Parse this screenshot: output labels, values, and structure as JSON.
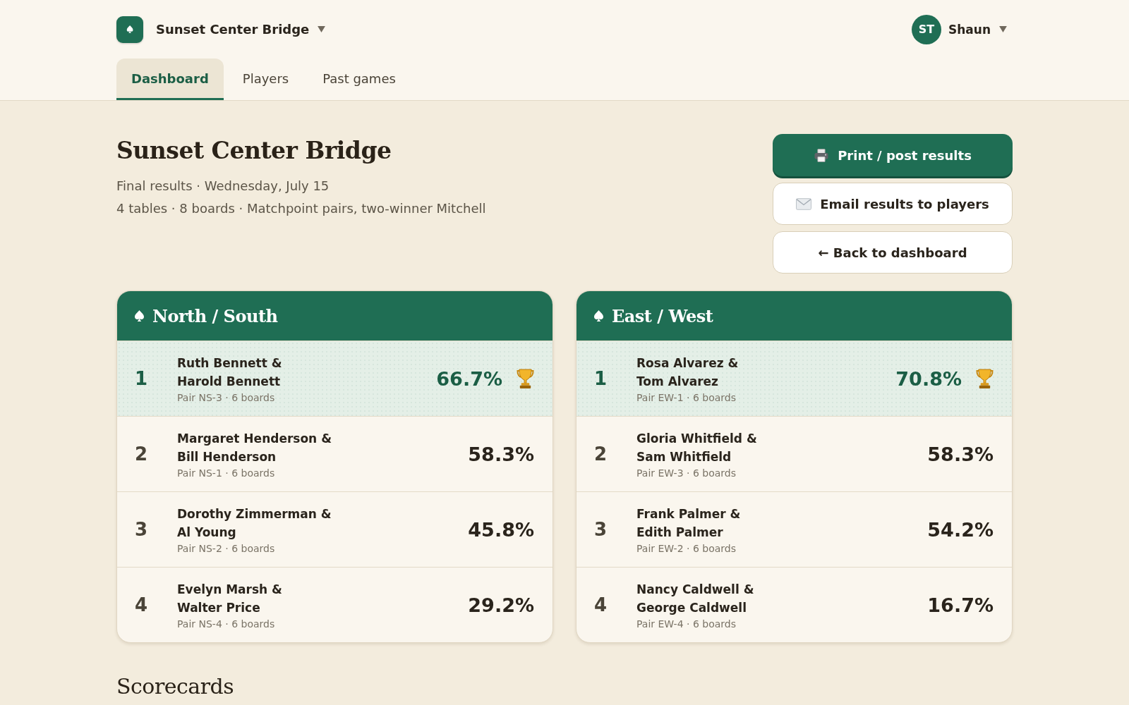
{
  "header": {
    "club": "Sunset Center Bridge",
    "user": {
      "initials": "ST",
      "name": "Shaun"
    }
  },
  "tabs": [
    {
      "label": "Dashboard",
      "selected": true
    },
    {
      "label": "Players",
      "selected": false
    },
    {
      "label": "Past games",
      "selected": false
    }
  ],
  "page": {
    "title": "Sunset Center Bridge",
    "subtitle_lines": [
      "Final results · Wednesday, July 15",
      "4 tables · 8 boards · Matchpoint pairs, two-winner Mitchell"
    ]
  },
  "actions": [
    {
      "label": "Print / post results",
      "kind": "print"
    },
    {
      "label": "Email results to players",
      "kind": "email"
    },
    {
      "label": "← Back to dashboard",
      "kind": "back"
    }
  ],
  "standings": [
    {
      "direction": "North / South",
      "pairs": [
        {
          "rank": "1",
          "names": [
            "Ruth Bennett &",
            "Harold Bennett"
          ],
          "detail": "Pair NS-3 · 6 boards",
          "score": "66.7%",
          "winner": true
        },
        {
          "rank": "2",
          "names": [
            "Margaret Henderson &",
            "Bill Henderson"
          ],
          "detail": "Pair NS-1 · 6 boards",
          "score": "58.3%",
          "winner": false
        },
        {
          "rank": "3",
          "names": [
            "Dorothy Zimmerman &",
            "Al Young"
          ],
          "detail": "Pair NS-2 · 6 boards",
          "score": "45.8%",
          "winner": false
        },
        {
          "rank": "4",
          "names": [
            "Evelyn Marsh &",
            "Walter Price"
          ],
          "detail": "Pair NS-4 · 6 boards",
          "score": "29.2%",
          "winner": false
        }
      ]
    },
    {
      "direction": "East / West",
      "pairs": [
        {
          "rank": "1",
          "names": [
            "Rosa Alvarez &",
            "Tom Alvarez"
          ],
          "detail": "Pair EW-1 · 6 boards",
          "score": "70.8%",
          "winner": true
        },
        {
          "rank": "2",
          "names": [
            "Gloria Whitfield &",
            "Sam Whitfield"
          ],
          "detail": "Pair EW-3 · 6 boards",
          "score": "58.3%",
          "winner": false
        },
        {
          "rank": "3",
          "names": [
            "Frank Palmer &",
            "Edith Palmer"
          ],
          "detail": "Pair EW-2 · 6 boards",
          "score": "54.2%",
          "winner": false
        },
        {
          "rank": "4",
          "names": [
            "Nancy Caldwell &",
            "George Caldwell"
          ],
          "detail": "Pair EW-4 · 6 boards",
          "score": "16.7%",
          "winner": false
        }
      ]
    }
  ],
  "section_heading": "Scorecards"
}
